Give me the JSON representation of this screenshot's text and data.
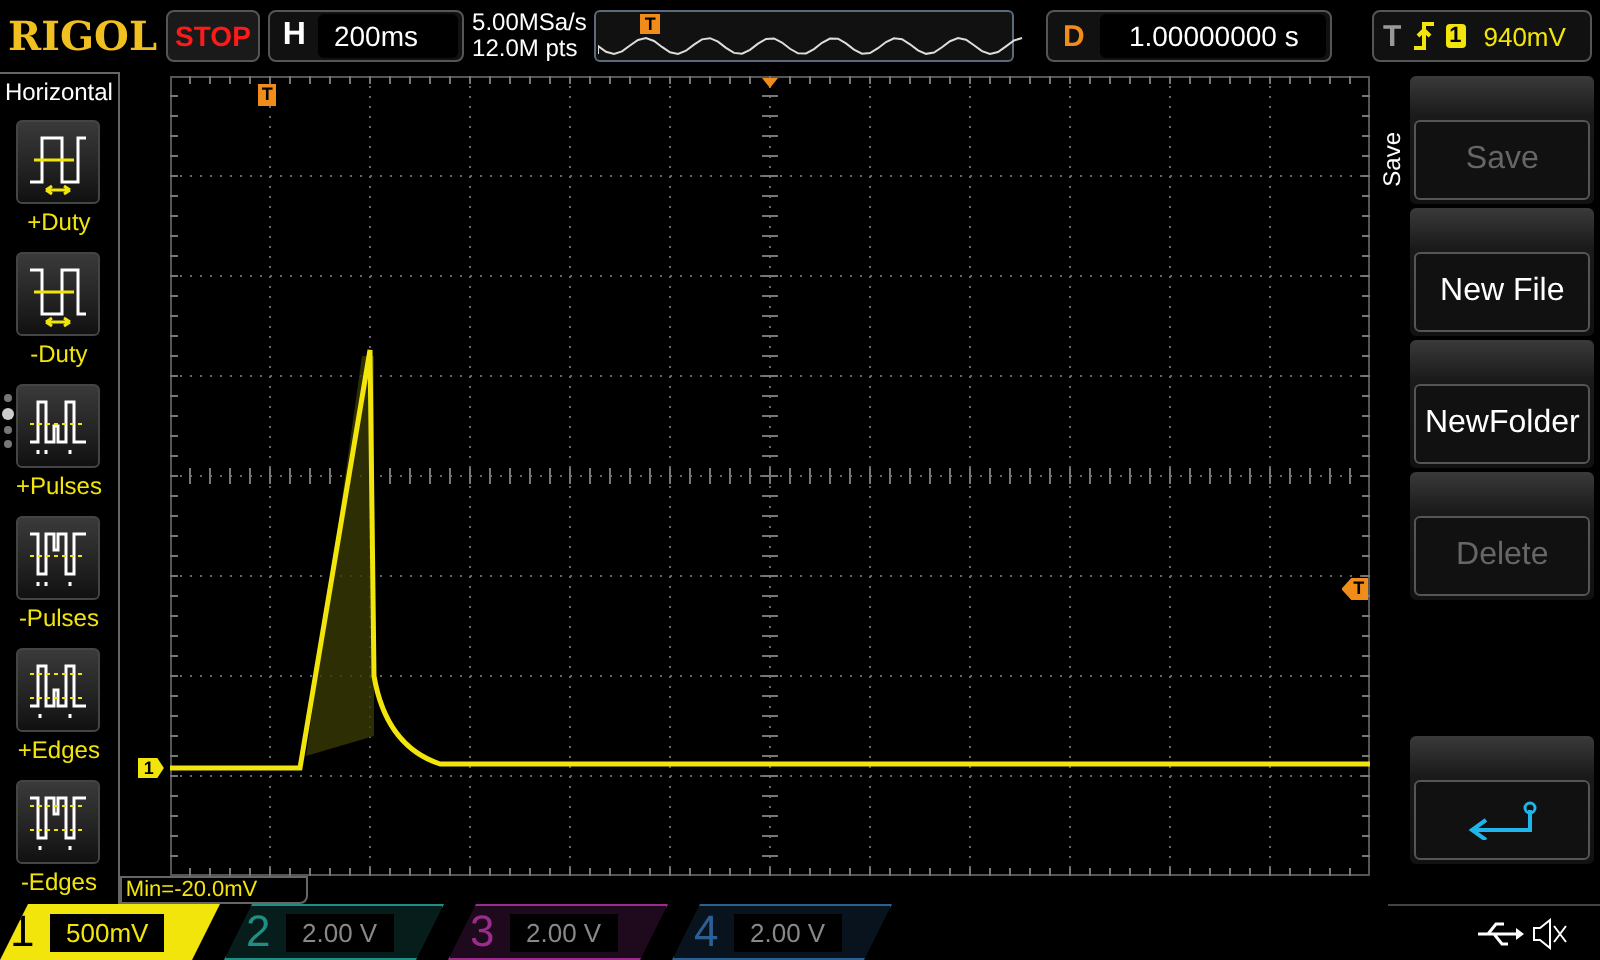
{
  "brand": "RIGOL",
  "run_state": "STOP",
  "horizontal": {
    "label": "H",
    "timebase": "200ms",
    "sample_rate": "5.00MSa/s",
    "memory_depth": "12.0M pts",
    "overview_trigger": "T"
  },
  "delay": {
    "label": "D",
    "value": "1.00000000 s"
  },
  "trigger": {
    "label": "T",
    "source": "1",
    "level": "940mV"
  },
  "left_menu": {
    "title": "Horizontal",
    "page_dots": [
      {
        "selected": false
      },
      {
        "selected": true
      },
      {
        "selected": false
      },
      {
        "selected": false
      }
    ],
    "items": [
      {
        "label": "+Duty",
        "kind": "pos-duty"
      },
      {
        "label": "-Duty",
        "kind": "neg-duty"
      },
      {
        "label": "+Pulses",
        "kind": "pos-pulses"
      },
      {
        "label": "-Pulses",
        "kind": "neg-pulses"
      },
      {
        "label": "+Edges",
        "kind": "pos-edges"
      },
      {
        "label": "-Edges",
        "kind": "neg-edges"
      }
    ]
  },
  "grid_markers": {
    "trigger_position": "T",
    "trigger_level": "T",
    "channel": "1"
  },
  "measurement": "Min=-20.0mV",
  "right_menu": {
    "title": "Save",
    "buttons": [
      {
        "label": "Save",
        "disabled": true
      },
      {
        "label": "New File",
        "disabled": false
      },
      {
        "label": "NewFolder",
        "disabled": false
      },
      {
        "label": "Delete",
        "disabled": true
      }
    ]
  },
  "channels": [
    {
      "number": "1",
      "scale": "500mV",
      "on": true,
      "color": "#f2e50c"
    },
    {
      "number": "2",
      "scale": "2.00 V",
      "on": false,
      "color": "#1f8f86"
    },
    {
      "number": "3",
      "scale": "2.00 V",
      "on": false,
      "color": "#9c2c8c"
    },
    {
      "number": "4",
      "scale": "2.00 V",
      "on": false,
      "color": "#2c5f93"
    }
  ]
}
